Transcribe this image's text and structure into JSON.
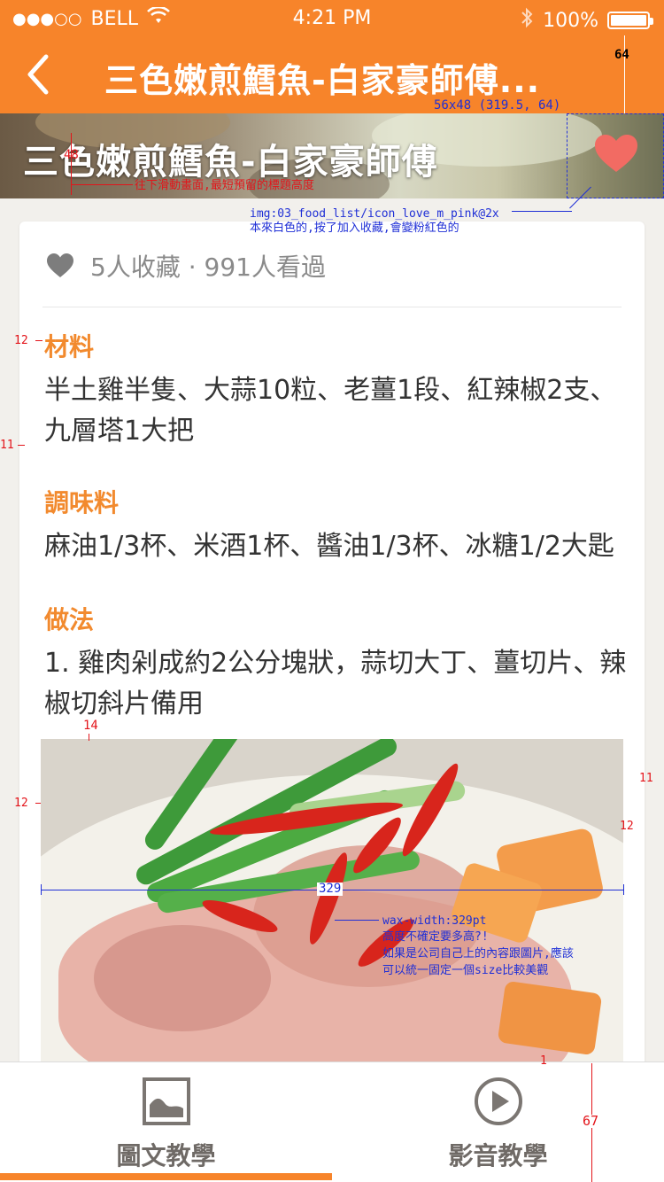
{
  "status": {
    "signal": "●●●○○",
    "carrier": "BELL",
    "time": "4:21 PM",
    "battery": "100%"
  },
  "nav": {
    "title": "三色嫩煎鱈魚-白家豪師傅..."
  },
  "hero": {
    "title": "三色嫩煎鱈魚-白家豪師傅"
  },
  "stats": {
    "text": "5人收藏 · 991人看過"
  },
  "sections": {
    "ingredients_title": "材料",
    "ingredients_text": "半土雞半隻、大蒜10粒、老薑1段、紅辣椒2支、九層塔1大把",
    "seasoning_title": "調味料",
    "seasoning_text": "麻油1/3杯、米酒1杯、醬油1/3杯、冰糖1/2大匙",
    "method_title": "做法",
    "step1": "1.  雞肉剁成約2公分塊狀，蒜切大丁、薑切片、辣椒切斜片備用"
  },
  "tabs": [
    {
      "label": "圖文教學",
      "icon": "image-icon",
      "active": true
    },
    {
      "label": "影音教學",
      "icon": "play-circle-icon",
      "active": false
    }
  ],
  "annotations": {
    "nav_height": "64",
    "heart_box": "56x48 (319.5, 64)",
    "title_height": "48",
    "title_note": "往下滑動畫面,最短預留的標題高度",
    "heart_img": "img:03_food_list/icon_love_m_pink@2x",
    "heart_note": "本來白色的,按了加入收藏,會變粉紅色的",
    "gap_12a": "12",
    "gap_11a": "11",
    "gap_14": "14",
    "gap_12b": "12",
    "gap_11b": "11",
    "gap_12c": "12",
    "img_width": "329",
    "img_note1": "wax-width:329pt",
    "img_note2": "高度不確定要多高?!",
    "img_note3": "如果是公司自己上的內容跟圖片,應該",
    "img_note4": "可以統一固定一個size比較美觀",
    "gap_1": "1",
    "tab_height": "67"
  },
  "colors": {
    "brand_orange": "#f7842a",
    "section_orange": "#f28a2e",
    "heart_pink": "#f26b63",
    "annotation_red": "#e3141a",
    "annotation_blue": "#1f2fd6"
  }
}
